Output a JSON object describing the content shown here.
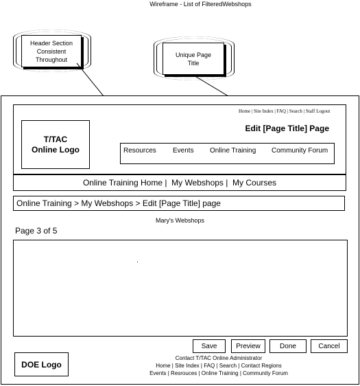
{
  "diagram_title": "Wireframe - List of FilteredWebshops",
  "callouts": {
    "header": "Header Section Consistent Throughout",
    "title": "Unique Page Title"
  },
  "header": {
    "utility_links": [
      "Home",
      "Site Index",
      "FAQ",
      "Search",
      "Staff Logout"
    ],
    "page_title": "Edit [Page Title] Page",
    "logo": "T/TAC Online Logo",
    "nav": [
      "Resources",
      "Events",
      "Online Training",
      "Community Forum"
    ]
  },
  "subnav": "Online Training Home |  My Webshops |  My Courses",
  "breadcrumb": "Online Training > My Webshops > Edit [Page Title] page",
  "content_title": "Mary's Webshops",
  "page_info": "Page 3 of 5",
  "buttons": {
    "save": "Save",
    "preview": "Preview",
    "done": "Done",
    "cancel": "Cancel"
  },
  "footer": {
    "logo": "DOE Logo",
    "contact": "Contact T/TAC Online Administrator",
    "links1": "Home | Site Index | FAQ | Search | Contact Regions",
    "links2": "Events | Resrouces | Online Training | Community Forum"
  }
}
